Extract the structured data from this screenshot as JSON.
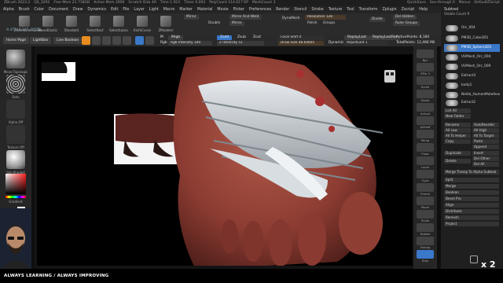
{
  "titlebar": {
    "app": "ZBrush 2023.2",
    "version": "QS_3292",
    "free_mem": "Free Mem 21.718GB",
    "active_mem": "Active Mem 2800",
    "scratch_disk": "Scratch Disk 49",
    "time": "Time 1.923",
    "timer": "Timer 0.003",
    "poly_count": "PolyCount 114.617 KP",
    "mesh_count": "MeshCount 3",
    "quicksave": "QuickSave",
    "see_through": "See-through 0",
    "menus": "Menus",
    "default_script": "DefaultZScript"
  },
  "menubar": [
    "Alpha",
    "Brush",
    "Color",
    "Document",
    "Draw",
    "Dynamics",
    "Edit",
    "File",
    "Layer",
    "Light",
    "Macro",
    "Marker",
    "Material",
    "Movie",
    "Picker",
    "Preferences",
    "Render",
    "Stencil",
    "Stroke",
    "Texture",
    "Tool",
    "Transform",
    "Zplugin",
    "Zscript",
    "Help"
  ],
  "shelf": {
    "tools": [
      "ZRemesherGuide",
      "MoveElastic",
      "Standard",
      "SelectRect",
      "SelectLasso",
      "KnifeCurve",
      "ZModeler"
    ],
    "mirror_btn": "Mirror",
    "mirror_weld": "Mirror And Weld",
    "dynamesh": "DynaMesh",
    "double": "Double",
    "mirror2": "Mirror",
    "resolution": "Resolution 128",
    "polish": "Polish",
    "groups": "Groups",
    "divide": "Divide",
    "del_hidden": "Del Hidden",
    "ruler_groups": "Ruler Groups"
  },
  "toolbar": {
    "home": "Home Page",
    "lightbox": "LightBox",
    "live_boolean": "Live Boolean",
    "mrgb": "Mrgb",
    "rgb": "Rgb",
    "m": "M",
    "zadd": "Zadd",
    "zsub": "Zsub",
    "zcut": "Zcut",
    "rgb_intensity": "Rgb Intensity 100",
    "z_intensity": "Z Intensity 51",
    "focal_shift": "Focal Shift 0",
    "draw_size": "Draw Size 48.64605",
    "dynamic": "Dynamic",
    "replay_last": "ReplayLast",
    "replay_last_rel": "ReplayLastRel",
    "adjust_last": "AdjustLast 1",
    "active_points": "ActivePoints: 8,184",
    "total_points": "TotalPoints: 12,466 Mil",
    "coords": "-0.479,-0.307,-0.575"
  },
  "lefttray": {
    "brush": "Move Topologic",
    "stroke": "Dots",
    "alpha": "Alpha Off",
    "texture": "Texture Off",
    "material": "SkinShade4",
    "gradient": "Gradient"
  },
  "righttray": [
    "Bpr",
    "SPix 3",
    "Scroll",
    "Zoom",
    "Actual",
    "AAHalf",
    "Persp",
    "Floor",
    "Local",
    "Gyro",
    "Frame",
    "Move",
    "Scale",
    "Rotate",
    "Transp",
    "Solo"
  ],
  "subtool": {
    "title": "Subtool",
    "visible_count": "Visible Count 9",
    "items": [
      {
        "label": "Orc_004",
        "selected": false
      },
      {
        "label": "PM3D_Cube3D1",
        "selected": false
      },
      {
        "label": "PM3D_Sphere3D1",
        "selected": true
      },
      {
        "label": "UVMesh_Orc_004",
        "selected": false
      },
      {
        "label": "UVMesh_Orc_009",
        "selected": false
      },
      {
        "label": "Extract3",
        "selected": false
      },
      {
        "label": "body1",
        "selected": false
      },
      {
        "label": "Nelda_HumanMaleAverage7",
        "selected": false
      },
      {
        "label": "Extract2",
        "selected": false
      }
    ],
    "buttons": {
      "list_all": "List All",
      "new_folder": "New Folder",
      "rename": "Rename",
      "autoreorder": "AutoReorder",
      "all_low": "All Low",
      "all_high": "All High",
      "all_to_helper": "All To Helper",
      "all_to_target": "All To Target",
      "copy": "Copy",
      "paste": "Paste",
      "append": "Append",
      "duplicate": "Duplicate",
      "insert": "Insert",
      "delete": "Delete",
      "del_other": "Del Other",
      "del_all": "Del All",
      "merge_transp": "Merge Transp To Alpha Subtool",
      "split": "Split",
      "merge": "Merge",
      "boolean": "Boolean",
      "bevel_pro": "Bevel Pro",
      "align": "Align",
      "distribute": "Distribute",
      "remesh": "Remesh",
      "project": "Project"
    }
  },
  "bottombar": "ALWAYS LEARNING  /  ALWAYS IMPROVING",
  "speed": "x 2",
  "colors": {
    "accent_orange": "#e88c1f",
    "accent_blue": "#3a78c9",
    "bg": "#0f0f0f"
  }
}
